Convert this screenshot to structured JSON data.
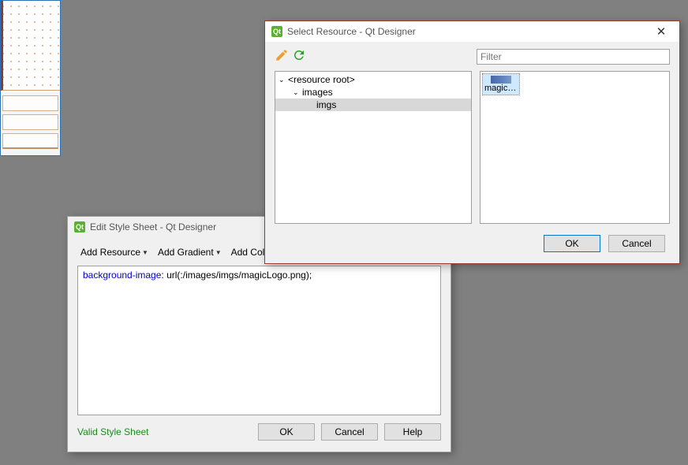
{
  "edit_dialog": {
    "title": "Edit Style Sheet - Qt Designer",
    "icon_text": "Qt",
    "toolbar": {
      "add_resource": "Add Resource",
      "add_gradient": "Add Gradient",
      "add_color": "Add Colo"
    },
    "css_prop": "background-image",
    "css_val": ": url(:/images/imgs/magicLogo.png);",
    "valid_text": "Valid Style Sheet",
    "buttons": {
      "ok": "OK",
      "cancel": "Cancel",
      "help": "Help"
    }
  },
  "select_dialog": {
    "title": "Select Resource - Qt Designer",
    "icon_text": "Qt",
    "filter_placeholder": "Filter",
    "tree": {
      "root": "<resource root>",
      "images": "images",
      "imgs": "imgs"
    },
    "resource_item": "magicLo...",
    "buttons": {
      "ok": "OK",
      "cancel": "Cancel"
    },
    "close": "✕"
  }
}
